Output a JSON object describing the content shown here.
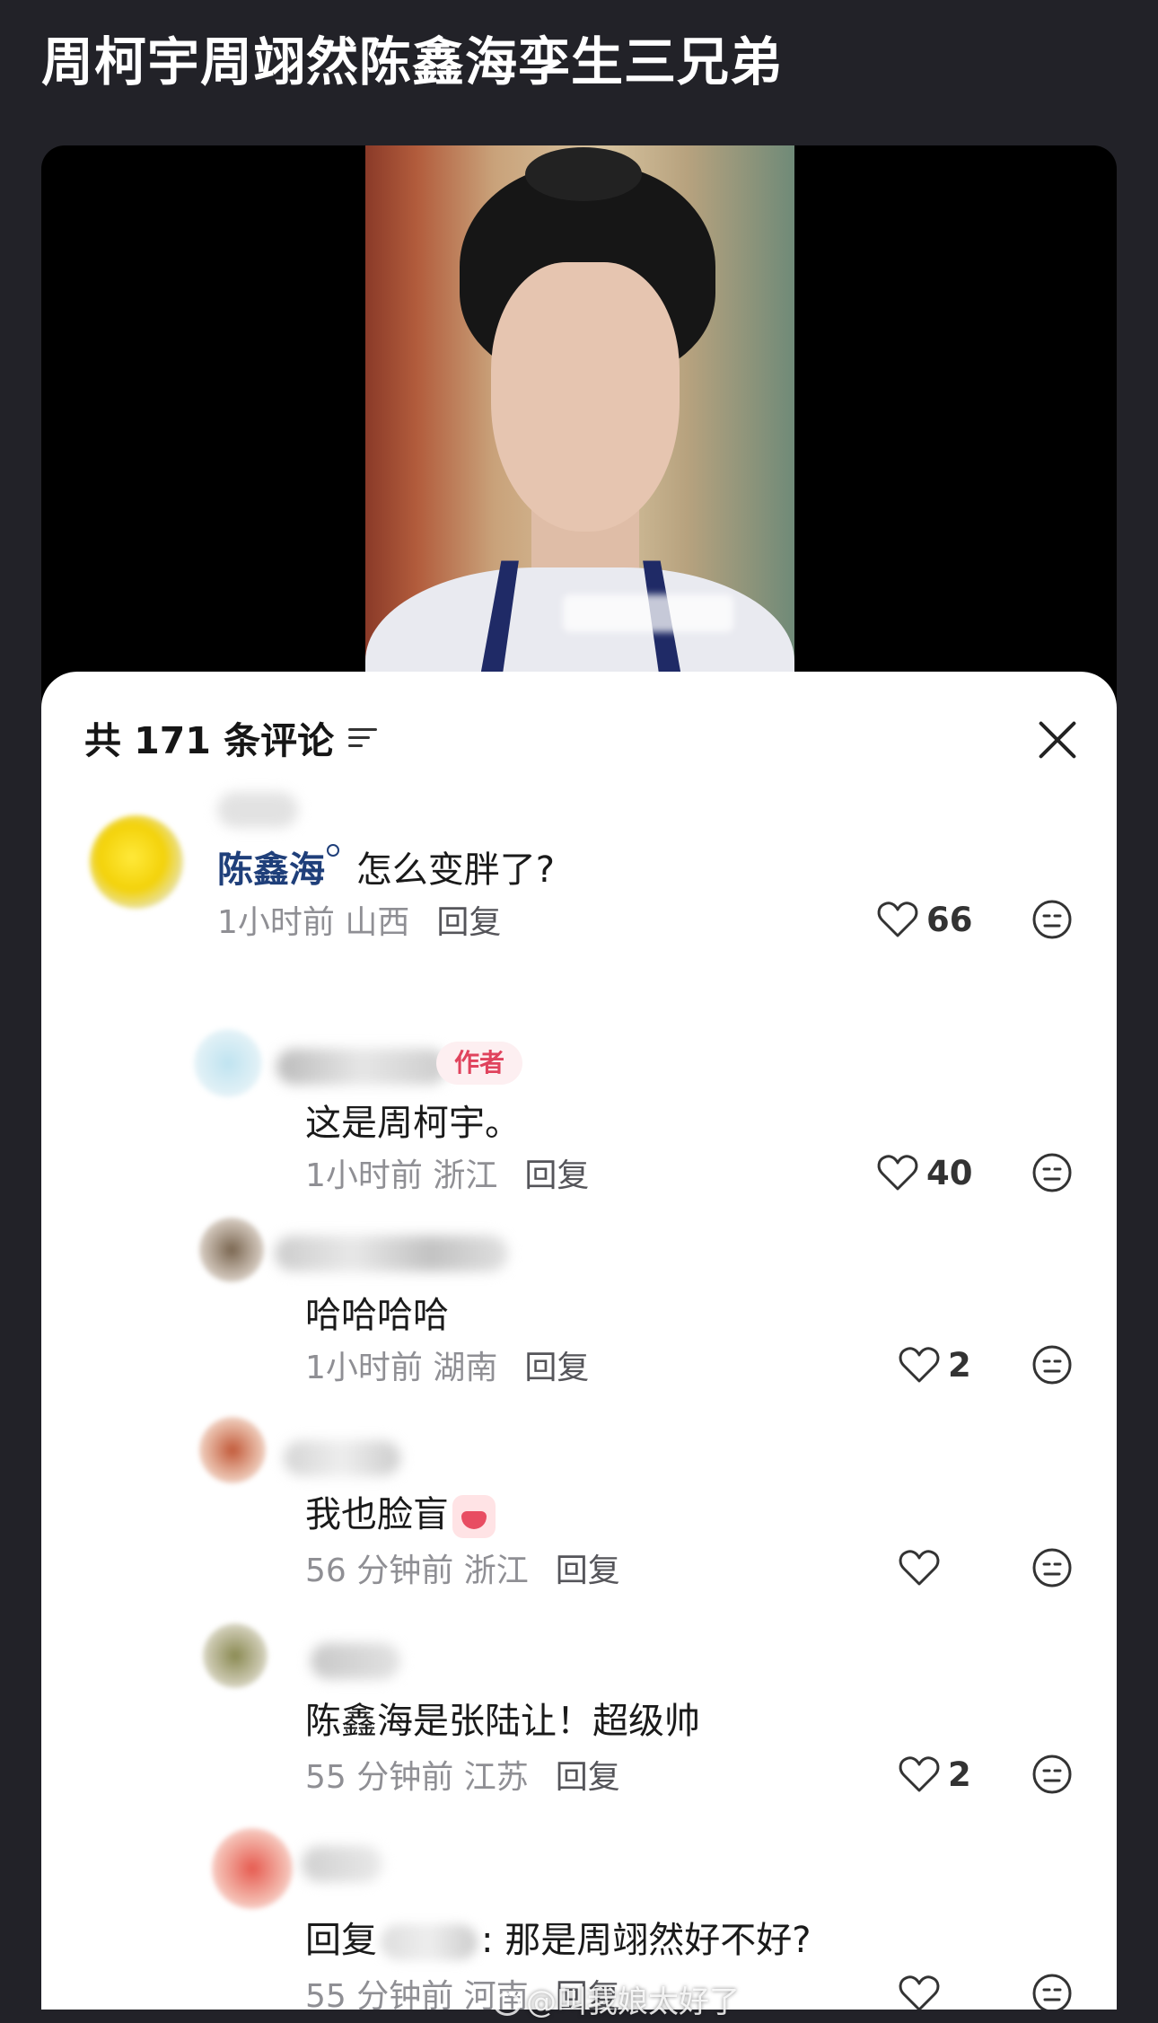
{
  "post": {
    "title": "周柯宇周翊然陈鑫海孪生三兄弟"
  },
  "watermark": "@叫我娘太好了",
  "comments_panel": {
    "count_label": "共 171 条评论",
    "comments": [
      {
        "mention": "陈鑫海",
        "text": " 怎么变胖了?",
        "time": "1小时前",
        "location": "山西",
        "reply_label": "回复",
        "likes": "66"
      },
      {
        "author_tag": "作者",
        "text": "这是周柯宇。",
        "time": "1小时前",
        "location": "浙江",
        "reply_label": "回复",
        "likes": "40"
      },
      {
        "text": "哈哈哈哈",
        "time": "1小时前",
        "location": "湖南",
        "reply_label": "回复",
        "likes": "2"
      },
      {
        "text": "我也脸盲",
        "time": "56 分钟前",
        "location": "浙江",
        "reply_label": "回复",
        "likes": ""
      },
      {
        "text": "陈鑫海是张陆让！超级帅",
        "time": "55 分钟前",
        "location": "江苏",
        "reply_label": "回复",
        "likes": "2"
      },
      {
        "reply_prefix": "回复",
        "text": ": 那是周翊然好不好?",
        "time": "55 分钟前",
        "location": "河南",
        "reply_label": "回复",
        "likes": ""
      }
    ]
  },
  "icons": {
    "filter": "sort-lines-icon",
    "close": "close-x-icon",
    "like": "heart-outline-icon",
    "dislike": "neutral-face-icon",
    "sticker": "crying-face-sticker-icon"
  },
  "colors": {
    "page_bg": "#222228",
    "sheet_bg": "#ffffff",
    "mention": "#1f3f7a",
    "author_tag_text": "#e0435d",
    "author_tag_bg": "#fdeff1",
    "meta": "#8f8f94"
  }
}
